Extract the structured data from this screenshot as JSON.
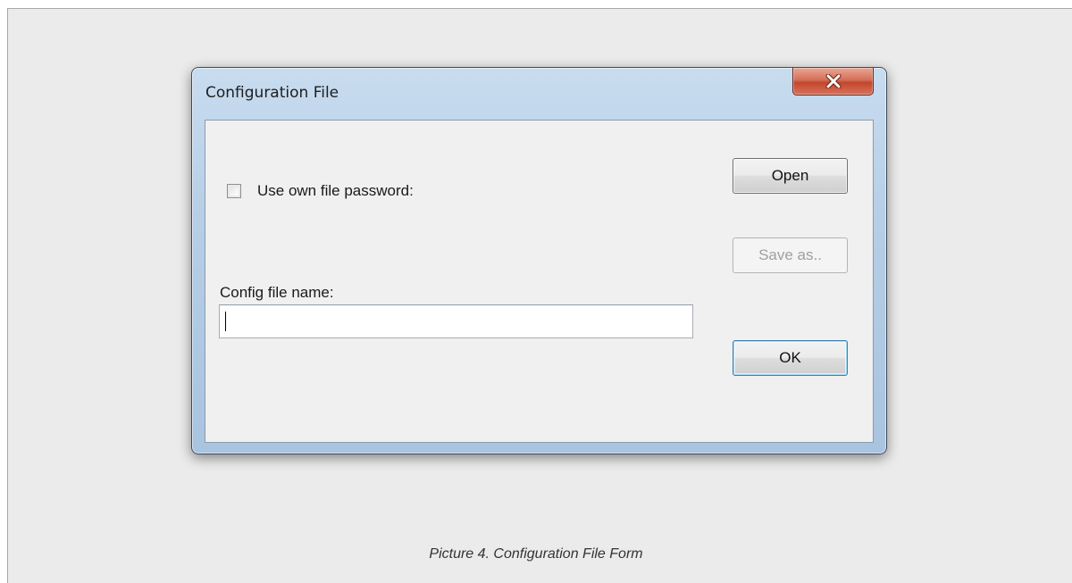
{
  "window": {
    "title": "Configuration File"
  },
  "form": {
    "use_password_label": "Use own file password:",
    "use_password_checked": false,
    "config_name_label": "Config file name:",
    "config_name_value": ""
  },
  "buttons": {
    "open_label": "Open",
    "save_as_label": "Save as..",
    "ok_label": "OK"
  },
  "icons": {
    "close": "close-x-icon"
  },
  "caption": "Picture 4. Configuration File Form"
}
